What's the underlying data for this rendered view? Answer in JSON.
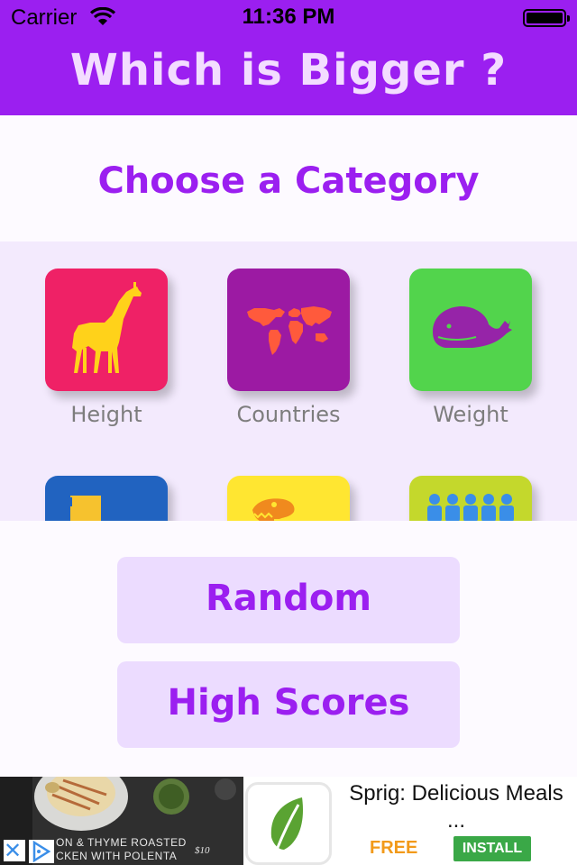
{
  "status_bar": {
    "carrier": "Carrier",
    "time": "11:36 PM"
  },
  "header": {
    "title": "Which is Bigger ?"
  },
  "main": {
    "heading": "Choose a Category",
    "categories": [
      {
        "label": "Height",
        "color": "#ef2166",
        "icon": "giraffe-icon"
      },
      {
        "label": "Countries",
        "color": "#9c1aa3",
        "icon": "world-map-icon"
      },
      {
        "label": "Weight",
        "color": "#52d44c",
        "icon": "whale-icon"
      },
      {
        "label": "",
        "color": "#2163c0",
        "icon": "building-icon"
      },
      {
        "label": "",
        "color": "#ffe631",
        "icon": "dinosaur-icon"
      },
      {
        "label": "",
        "color": "#c4d82c",
        "icon": "people-icon"
      }
    ],
    "buttons": {
      "random": "Random",
      "high_scores": "High Scores"
    }
  },
  "ad": {
    "image_caption_line1": "ON & THYME ROASTED",
    "image_caption_line2": "CKEN WITH POLENTA",
    "image_price": "$10",
    "title": "Sprig: Delicious Meals ...",
    "price": "FREE",
    "install": "INSTALL"
  },
  "colors": {
    "accent": "#9b1ff0",
    "light_accent": "#ecdcff",
    "grid_background": "#f3eafd"
  }
}
